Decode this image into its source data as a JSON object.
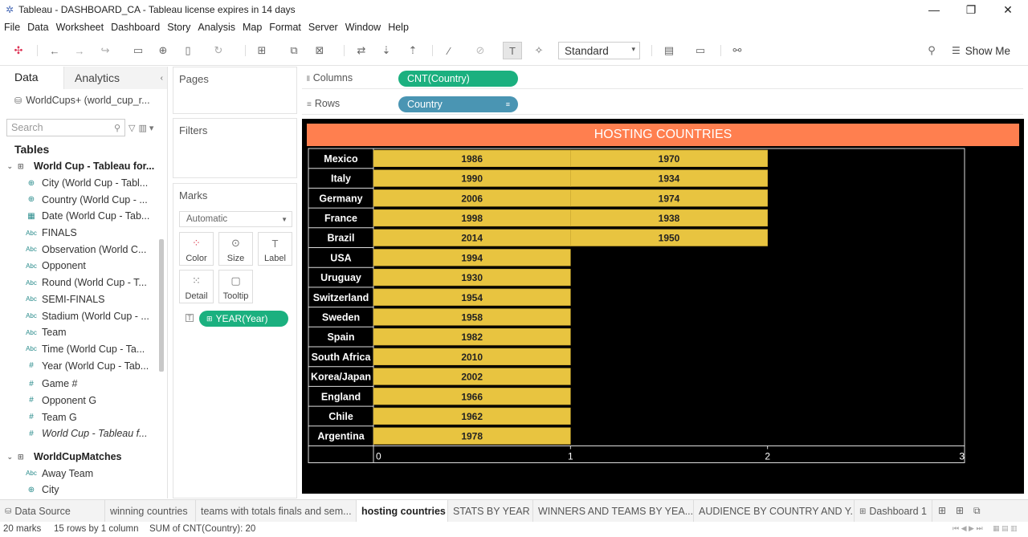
{
  "window": {
    "title": "Tableau - DASHBOARD_CA - Tableau license expires in 14 days"
  },
  "menu": [
    "File",
    "Data",
    "Worksheet",
    "Dashboard",
    "Story",
    "Analysis",
    "Map",
    "Format",
    "Server",
    "Window",
    "Help"
  ],
  "toolbar": {
    "fit_value": "Standard",
    "show_me_label": "Show Me"
  },
  "data_pane": {
    "tabs": [
      "Data",
      "Analytics"
    ],
    "datasource": "WorldCups+ (world_cup_r...",
    "search_placeholder": "Search",
    "tables_heading": "Tables",
    "groups": [
      {
        "label": "World Cup - Tableau for...",
        "fields": [
          {
            "label": "City (World Cup - Tabl...",
            "type": "geo-icon"
          },
          {
            "label": "Country (World Cup - ...",
            "type": "geo-icon"
          },
          {
            "label": "Date (World Cup - Tab...",
            "type": "date-icon"
          },
          {
            "label": "FINALS",
            "type": "abc-icon"
          },
          {
            "label": "Observation (World C...",
            "type": "abc-icon"
          },
          {
            "label": "Opponent",
            "type": "abc-icon"
          },
          {
            "label": "Round (World Cup - T...",
            "type": "abc-icon"
          },
          {
            "label": "SEMI-FINALS",
            "type": "abc-icon"
          },
          {
            "label": "Stadium (World Cup - ...",
            "type": "abc-icon"
          },
          {
            "label": "Team",
            "type": "abc-icon"
          },
          {
            "label": "Time (World Cup - Ta...",
            "type": "abc-icon"
          },
          {
            "label": "Year (World Cup - Tab...",
            "type": "number-icon"
          },
          {
            "label": "Game #",
            "type": "number-icon"
          },
          {
            "label": "Opponent G",
            "type": "number-icon"
          },
          {
            "label": "Team G",
            "type": "number-icon"
          },
          {
            "label": "World Cup - Tableau f...",
            "type": "number-icon",
            "italic": true
          }
        ]
      },
      {
        "label": "WorldCupMatches",
        "fields": [
          {
            "label": "Away Team",
            "type": "abc-icon"
          },
          {
            "label": "City",
            "type": "geo-icon"
          }
        ]
      }
    ]
  },
  "cards": {
    "pages": "Pages",
    "filters": "Filters",
    "marks": "Marks",
    "mark_type": "Automatic",
    "mark_buttons": [
      "Color",
      "Size",
      "Label",
      "Detail",
      "Tooltip"
    ],
    "label_pill": "YEAR(Year)"
  },
  "shelves": {
    "columns_label": "Columns",
    "columns_pill": "CNT(Country)",
    "rows_label": "Rows",
    "rows_pill": "Country"
  },
  "viz": {
    "title": "HOSTING COUNTRIES",
    "bar_color": "#e8c440",
    "title_bg": "#ff7f4f"
  },
  "chart_data": {
    "type": "bar",
    "orientation": "horizontal",
    "stacked": true,
    "title": "HOSTING COUNTRIES",
    "categories": [
      "Mexico",
      "Italy",
      "Germany",
      "France",
      "Brazil",
      "USA",
      "Uruguay",
      "Switzerland",
      "Sweden",
      "Spain",
      "South Africa",
      "Korea/Japan",
      "England",
      "Chile",
      "Argentina"
    ],
    "segments": [
      [
        "1986",
        "1970"
      ],
      [
        "1990",
        "1934"
      ],
      [
        "2006",
        "1974"
      ],
      [
        "1998",
        "1938"
      ],
      [
        "2014",
        "1950"
      ],
      [
        "1994"
      ],
      [
        "1930"
      ],
      [
        "1954"
      ],
      [
        "1958"
      ],
      [
        "1982"
      ],
      [
        "2010"
      ],
      [
        "2002"
      ],
      [
        "1966"
      ],
      [
        "1962"
      ],
      [
        "1978"
      ]
    ],
    "values": [
      2,
      2,
      2,
      2,
      2,
      1,
      1,
      1,
      1,
      1,
      1,
      1,
      1,
      1,
      1
    ],
    "x_ticks": [
      "0",
      "1",
      "2",
      "3"
    ],
    "xlim": [
      0,
      3
    ],
    "grid": false
  },
  "sheet_tabs": {
    "data_source": "Data Source",
    "tabs": [
      "winning countries",
      "teams with totals finals and sem...",
      "hosting countries",
      "STATS BY YEAR",
      "WINNERS AND TEAMS BY YEA...",
      "AUDIENCE BY COUNTRY AND Y...",
      "Dashboard 1"
    ],
    "active": "hosting countries"
  },
  "status": {
    "marks": "20 marks",
    "rows_cols": "15 rows by 1 column",
    "sum": "SUM of CNT(Country): 20"
  }
}
